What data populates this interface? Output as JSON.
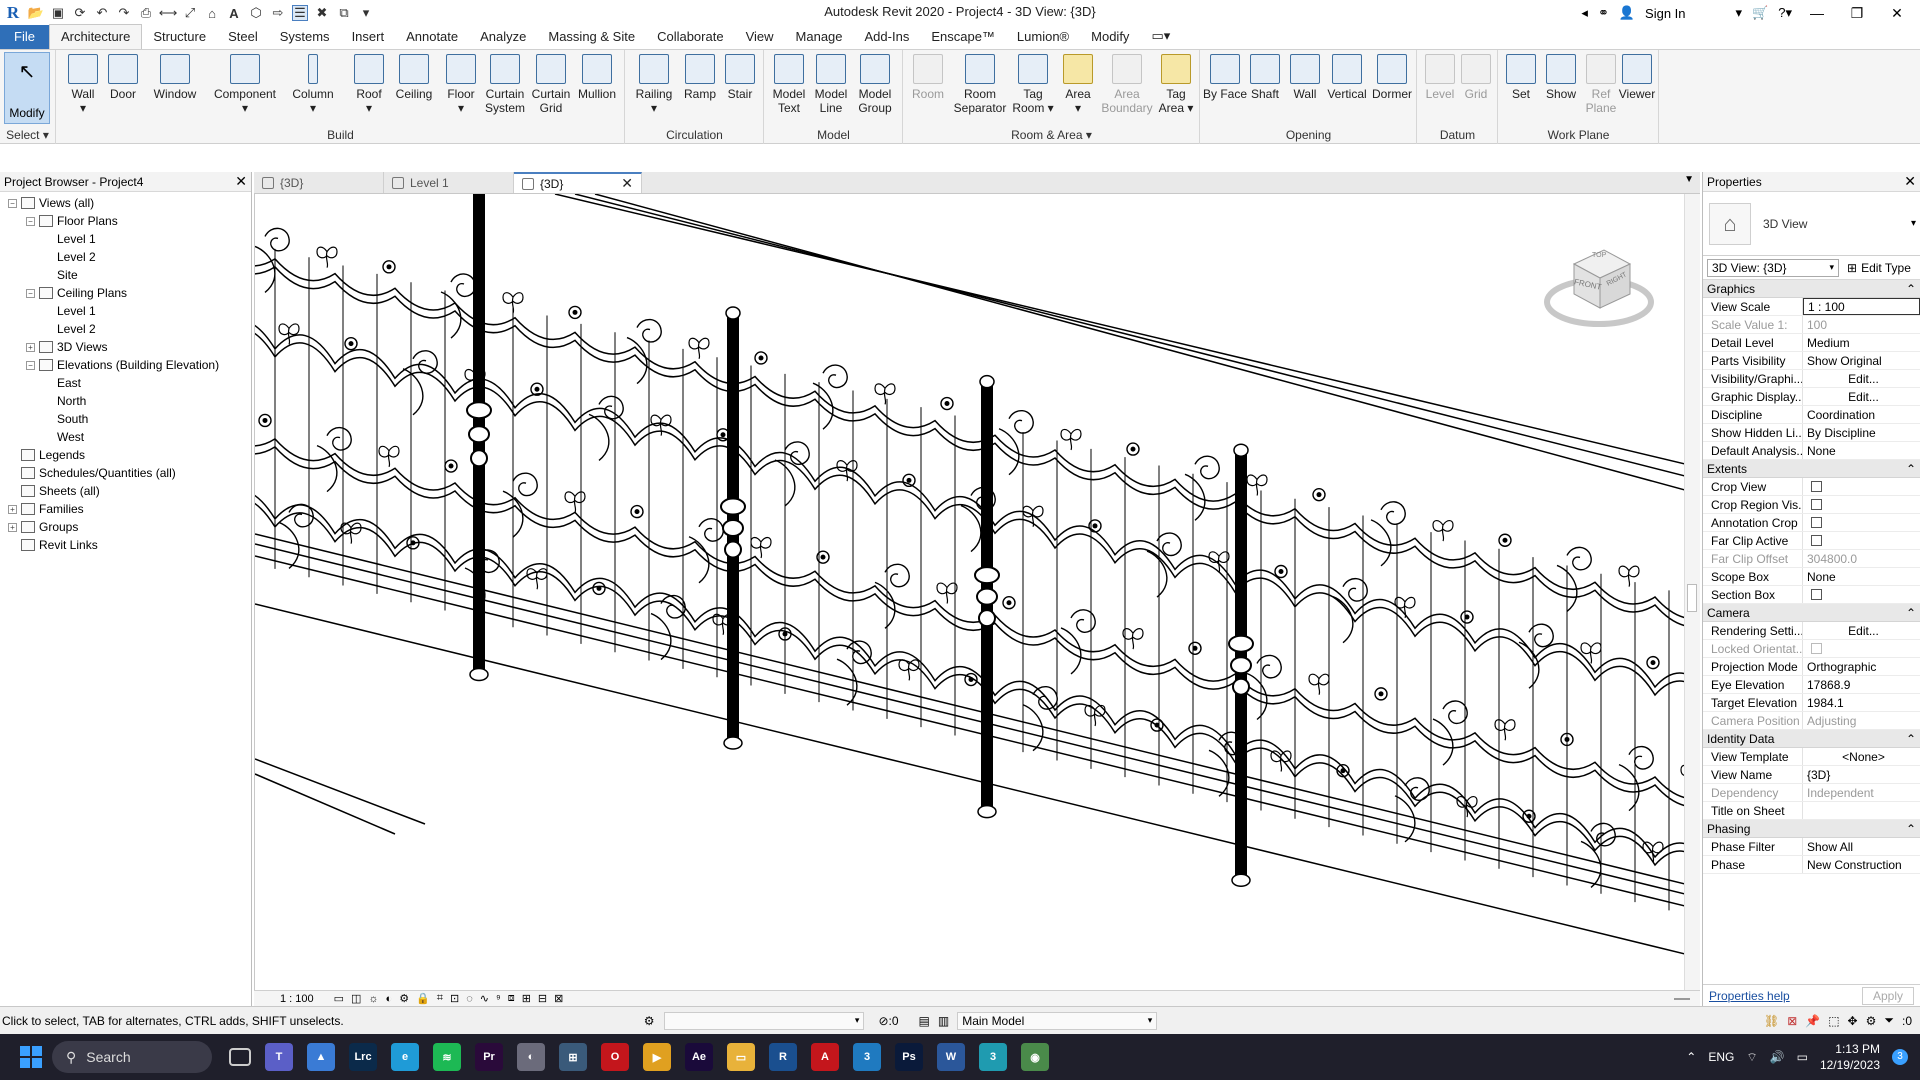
{
  "window": {
    "title": "Autodesk Revit 2020 - Project4 - 3D View: {3D}",
    "sign_in": "Sign In"
  },
  "ribbon_tabs": [
    "File",
    "Architecture",
    "Structure",
    "Steel",
    "Systems",
    "Insert",
    "Annotate",
    "Analyze",
    "Massing & Site",
    "Collaborate",
    "View",
    "Manage",
    "Add-Ins",
    "Enscape™",
    "Lumion®",
    "Modify"
  ],
  "ribbon": {
    "select_label": "Select",
    "modify": "Modify",
    "build": {
      "label": "Build",
      "buttons": [
        "Wall",
        "Door",
        "Window",
        "Component",
        "Column",
        "Roof",
        "Ceiling",
        "Floor",
        "Curtain System",
        "Curtain Grid",
        "Mullion"
      ]
    },
    "circulation": {
      "label": "Circulation",
      "buttons": [
        "Railing",
        "Ramp",
        "Stair"
      ]
    },
    "model": {
      "label": "Model",
      "buttons": [
        "Model Text",
        "Model Line",
        "Model Group"
      ]
    },
    "room_area": {
      "label": "Room & Area",
      "buttons": [
        "Room",
        "Room Separator",
        "Tag Room",
        "Area",
        "Area Boundary",
        "Tag Area"
      ]
    },
    "opening": {
      "label": "Opening",
      "buttons": [
        "By Face",
        "Shaft",
        "Wall",
        "Vertical",
        "Dormer"
      ]
    },
    "datum": {
      "label": "Datum",
      "buttons": [
        "Level",
        "Grid"
      ]
    },
    "work_plane": {
      "label": "Work Plane",
      "buttons": [
        "Set",
        "Show",
        "Ref Plane",
        "Viewer"
      ]
    }
  },
  "project_browser": {
    "title": "Project Browser - Project4",
    "tree": [
      {
        "label": "Views (all)",
        "level": 0,
        "toggle": "−"
      },
      {
        "label": "Floor Plans",
        "level": 1,
        "toggle": "−"
      },
      {
        "label": "Level 1",
        "level": 2
      },
      {
        "label": "Level 2",
        "level": 2
      },
      {
        "label": "Site",
        "level": 2
      },
      {
        "label": "Ceiling Plans",
        "level": 1,
        "toggle": "−"
      },
      {
        "label": "Level 1",
        "level": 2
      },
      {
        "label": "Level 2",
        "level": 2
      },
      {
        "label": "3D Views",
        "level": 1,
        "toggle": "+"
      },
      {
        "label": "Elevations (Building Elevation)",
        "level": 1,
        "toggle": "−"
      },
      {
        "label": "East",
        "level": 2
      },
      {
        "label": "North",
        "level": 2
      },
      {
        "label": "South",
        "level": 2
      },
      {
        "label": "West",
        "level": 2
      },
      {
        "label": "Legends",
        "level": 0,
        "icon": true
      },
      {
        "label": "Schedules/Quantities (all)",
        "level": 0,
        "icon": true
      },
      {
        "label": "Sheets (all)",
        "level": 0,
        "icon": true
      },
      {
        "label": "Families",
        "level": 0,
        "toggle": "+",
        "icon": true
      },
      {
        "label": "Groups",
        "level": 0,
        "toggle": "+",
        "icon": true
      },
      {
        "label": "Revit Links",
        "level": 0,
        "icon": true
      }
    ]
  },
  "doc_tabs": [
    {
      "label": "{3D}",
      "active": false
    },
    {
      "label": "Level 1",
      "active": false
    },
    {
      "label": "{3D}",
      "active": true
    }
  ],
  "viewcube": {
    "top": "TOP",
    "front": "FRONT",
    "right": "RIGHT"
  },
  "view_control_bar": {
    "scale": "1 : 100"
  },
  "properties": {
    "title": "Properties",
    "type_name": "3D View",
    "selector": "3D View: {3D}",
    "edit_type": "Edit Type",
    "groups": [
      {
        "name": "Graphics",
        "rows": [
          {
            "name": "View Scale",
            "value": "1 : 100",
            "kind": "input"
          },
          {
            "name": "Scale Value    1:",
            "value": "100",
            "disabled": true
          },
          {
            "name": "Detail Level",
            "value": "Medium"
          },
          {
            "name": "Parts Visibility",
            "value": "Show Original"
          },
          {
            "name": "Visibility/Graphi...",
            "value": "Edit...",
            "kind": "button"
          },
          {
            "name": "Graphic Display...",
            "value": "Edit...",
            "kind": "button"
          },
          {
            "name": "Discipline",
            "value": "Coordination"
          },
          {
            "name": "Show Hidden Li...",
            "value": "By Discipline"
          },
          {
            "name": "Default Analysis...",
            "value": "None"
          }
        ]
      },
      {
        "name": "Extents",
        "rows": [
          {
            "name": "Crop View",
            "value": "",
            "kind": "check"
          },
          {
            "name": "Crop Region Vis...",
            "value": "",
            "kind": "check"
          },
          {
            "name": "Annotation Crop",
            "value": "",
            "kind": "check"
          },
          {
            "name": "Far Clip Active",
            "value": "",
            "kind": "check"
          },
          {
            "name": "Far Clip Offset",
            "value": "304800.0",
            "disabled": true
          },
          {
            "name": "Scope Box",
            "value": "None"
          },
          {
            "name": "Section Box",
            "value": "",
            "kind": "check"
          }
        ]
      },
      {
        "name": "Camera",
        "rows": [
          {
            "name": "Rendering Setti...",
            "value": "Edit...",
            "kind": "button"
          },
          {
            "name": "Locked Orientat...",
            "value": "",
            "kind": "check",
            "disabled": true
          },
          {
            "name": "Projection Mode",
            "value": "Orthographic"
          },
          {
            "name": "Eye Elevation",
            "value": "17868.9"
          },
          {
            "name": "Target Elevation",
            "value": "1984.1"
          },
          {
            "name": "Camera Position",
            "value": "Adjusting",
            "disabled": true
          }
        ]
      },
      {
        "name": "Identity Data",
        "rows": [
          {
            "name": "View Template",
            "value": "<None>",
            "kind": "button"
          },
          {
            "name": "View Name",
            "value": "{3D}"
          },
          {
            "name": "Dependency",
            "value": "Independent",
            "disabled": true
          },
          {
            "name": "Title on Sheet",
            "value": ""
          }
        ]
      },
      {
        "name": "Phasing",
        "rows": [
          {
            "name": "Phase Filter",
            "value": "Show All"
          },
          {
            "name": "Phase",
            "value": "New Construction"
          }
        ]
      }
    ],
    "help": "Properties help",
    "apply": "Apply"
  },
  "status": {
    "hint": "Click to select, TAB for alternates, CTRL adds, SHIFT unselects.",
    "filter_count": ":0",
    "model": "Main Model",
    "sel_count": ":0"
  },
  "taskbar": {
    "search": "Search",
    "lang": "ENG",
    "time": "1:13 PM",
    "date": "12/19/2023",
    "notif": "3",
    "apps": [
      {
        "name": "teams-icon",
        "color": "#5b5fc7",
        "glyph": "T"
      },
      {
        "name": "photos-icon",
        "color": "#3a7bd5",
        "glyph": "▲"
      },
      {
        "name": "lightroom-icon",
        "color": "#0b2a4a",
        "glyph": "Lrc"
      },
      {
        "name": "edge-icon",
        "color": "#1f9bd7",
        "glyph": "e"
      },
      {
        "name": "spotify-icon",
        "color": "#1db954",
        "glyph": "≋"
      },
      {
        "name": "premiere-icon",
        "color": "#2a0a3a",
        "glyph": "Pr"
      },
      {
        "name": "globe-icon",
        "color": "#6b6b7b",
        "glyph": "◐"
      },
      {
        "name": "calculator-icon",
        "color": "#3a5a7a",
        "glyph": "⊞"
      },
      {
        "name": "opera-icon",
        "color": "#c4161c",
        "glyph": "O"
      },
      {
        "name": "media-icon",
        "color": "#e0a020",
        "glyph": "▶"
      },
      {
        "name": "after-effects-icon",
        "color": "#1a0a3a",
        "glyph": "Ae"
      },
      {
        "name": "explorer-icon",
        "color": "#e8b23a",
        "glyph": "▭"
      },
      {
        "name": "revit-icon",
        "color": "#1a4f8f",
        "glyph": "R"
      },
      {
        "name": "autocad-icon",
        "color": "#c4161c",
        "glyph": "A"
      },
      {
        "name": "app-3-icon",
        "color": "#1f7ac0",
        "glyph": "3"
      },
      {
        "name": "photoshop-icon",
        "color": "#0a1a3a",
        "glyph": "Ps"
      },
      {
        "name": "word-icon",
        "color": "#2b579a",
        "glyph": "W"
      },
      {
        "name": "app-3b-icon",
        "color": "#1f9bb0",
        "glyph": "3"
      },
      {
        "name": "chrome-icon",
        "color": "#4a8a4a",
        "glyph": "◉"
      }
    ]
  },
  "colors": {
    "accent": "#2f6fb8",
    "taskbar": "#1f1f2b",
    "ribbon": "#f5f5f5"
  }
}
